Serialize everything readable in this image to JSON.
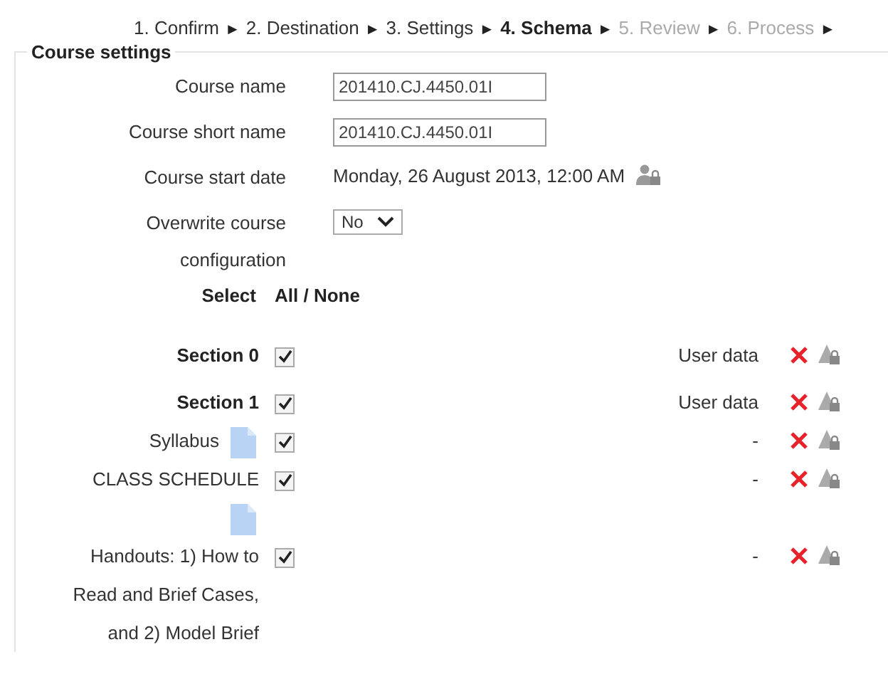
{
  "breadcrumb": {
    "separator": "►",
    "steps": [
      {
        "label": "1. Confirm",
        "current": false,
        "disabled": false
      },
      {
        "label": "2. Destination",
        "current": false,
        "disabled": false
      },
      {
        "label": "3. Settings",
        "current": false,
        "disabled": false
      },
      {
        "label": "4. Schema",
        "current": true,
        "disabled": false
      },
      {
        "label": "5. Review",
        "current": false,
        "disabled": true
      },
      {
        "label": "6. Process",
        "current": false,
        "disabled": true
      }
    ]
  },
  "course_settings": {
    "legend": "Course settings",
    "fields": [
      {
        "kind": "text",
        "label": "Course name",
        "value": "201410.CJ.4450.01I"
      },
      {
        "kind": "text",
        "label": "Course short name",
        "value": "201410.CJ.4450.01I"
      },
      {
        "kind": "static",
        "label": "Course start date",
        "value": "Monday, 26 August 2013, 12:00 AM"
      },
      {
        "kind": "select",
        "label": "Overwrite course configuration",
        "value": "No"
      }
    ]
  },
  "select_row": {
    "label": "Select",
    "links": "All / None"
  },
  "schema": [
    {
      "kind": "section",
      "label": "Section 0",
      "checked": true,
      "has_icon": false,
      "user_data": "User data"
    },
    {
      "kind": "section",
      "label": "Section 1",
      "checked": true,
      "has_icon": false,
      "user_data": "User data"
    },
    {
      "kind": "activity",
      "label": "Syllabus",
      "checked": true,
      "has_icon": true,
      "user_data": "-"
    },
    {
      "kind": "activity",
      "label": "CLASS SCHEDULE",
      "checked": true,
      "has_icon": true,
      "user_data": "-"
    },
    {
      "kind": "activity",
      "label": "Handouts: 1) How to Read and Brief Cases, and 2) Model Brief",
      "checked": true,
      "has_icon": false,
      "user_data": "-"
    }
  ]
}
